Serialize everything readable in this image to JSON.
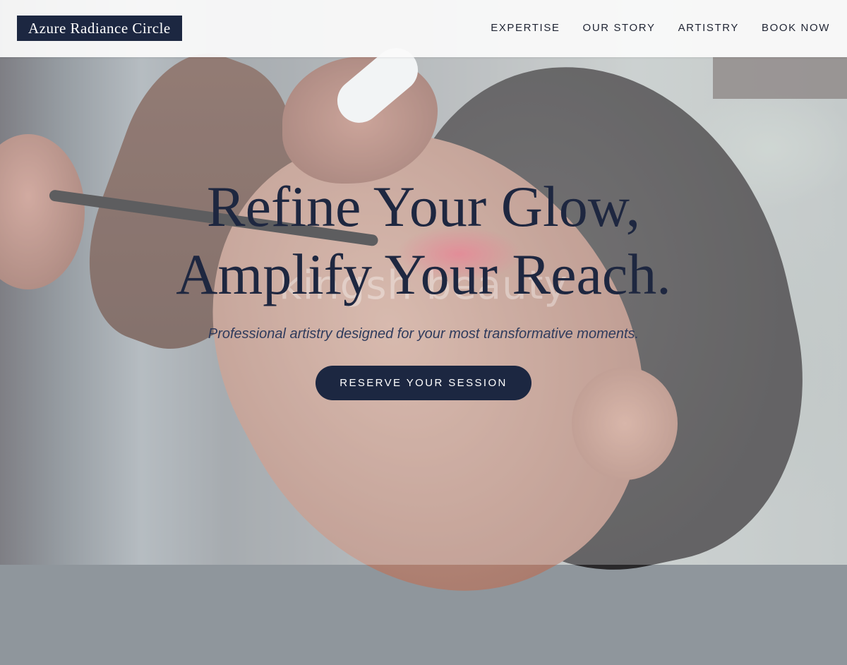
{
  "header": {
    "logo_text": "Azure Radiance Circle",
    "nav": [
      {
        "label": "EXPERTISE"
      },
      {
        "label": "OUR STORY"
      },
      {
        "label": "ARTISTRY"
      },
      {
        "label": "BOOK NOW"
      }
    ]
  },
  "hero": {
    "title_line1": "Refine Your Glow,",
    "title_line2": "Amplify Your Reach.",
    "subtitle": "Professional artistry designed for your most transformative moments.",
    "cta_label": "RESERVE YOUR SESSION",
    "watermark_text": "kingsh beauty"
  },
  "colors": {
    "brand_navy": "#1c2741",
    "header_bg": "#fafafa",
    "text_dark": "#1f2433"
  }
}
